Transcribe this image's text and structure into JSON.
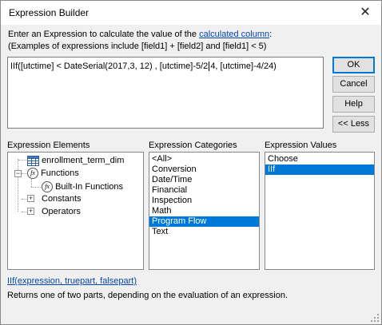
{
  "window": {
    "title": "Expression Builder",
    "close_glyph": "✕"
  },
  "intro": {
    "line1_prefix": "Enter an Expression to calculate the value of the ",
    "line1_link": "calculated column",
    "line1_suffix": ":",
    "line2": "(Examples of expressions include [field1] + [field2] and [field1] < 5)"
  },
  "expression": {
    "before_caret": "IIf([utctime] < DateSerial(2017,3, 12) , [utctime]-5/2",
    "after_caret": "4, [utctime]-4/24)"
  },
  "buttons": {
    "ok": "OK",
    "cancel": "Cancel",
    "help": "Help",
    "less": "<< Less"
  },
  "elements": {
    "label": "Expression Elements",
    "items": [
      {
        "label": "enrollment_term_dim",
        "icon": "table-icon"
      },
      {
        "label": "Functions",
        "icon": "function-icon",
        "expander": "−"
      },
      {
        "label": "Built-In Functions",
        "icon": "function-icon"
      },
      {
        "label": "Constants",
        "icon": "folder-icon",
        "expander": "+"
      },
      {
        "label": "Operators",
        "icon": "folder-icon",
        "expander": "+"
      }
    ]
  },
  "categories": {
    "label": "Expression Categories",
    "items": [
      "<All>",
      "Conversion",
      "Date/Time",
      "Financial",
      "Inspection",
      "Math",
      "Program Flow",
      "Text"
    ],
    "selected": "Program Flow"
  },
  "values": {
    "label": "Expression Values",
    "items": [
      "Choose",
      "IIf"
    ],
    "selected": "IIf"
  },
  "footer": {
    "syntax_link": "IIf(expression, truepart, falsepart)",
    "description": "Returns one of two parts, depending on the evaluation of an expression."
  },
  "colors": {
    "selection": "#0078d7",
    "link": "#0645ad",
    "default_button_border": "#0078d7"
  }
}
